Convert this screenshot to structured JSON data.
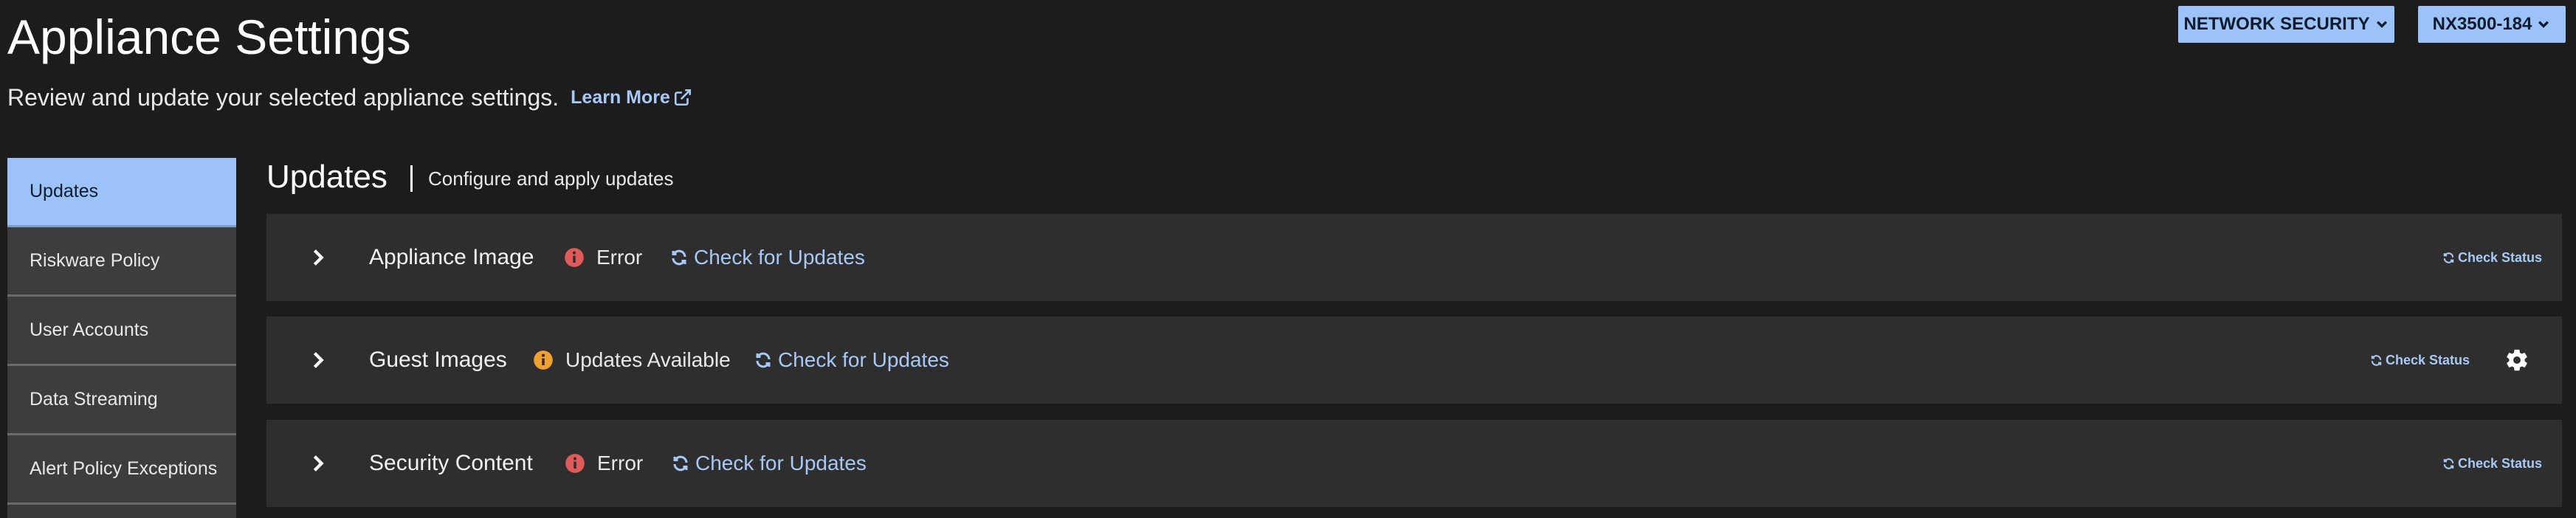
{
  "header": {
    "title": "Appliance Settings",
    "subtitle": "Review and update your selected appliance settings.",
    "learn_more": "Learn More",
    "buttons": {
      "network_security": "NETWORK SECURITY",
      "appliance": "NX3500-184"
    }
  },
  "sidebar": {
    "items": [
      {
        "label": "Updates",
        "active": true
      },
      {
        "label": "Riskware Policy",
        "active": false
      },
      {
        "label": "User Accounts",
        "active": false
      },
      {
        "label": "Data Streaming",
        "active": false
      },
      {
        "label": "Alert Policy Exceptions",
        "active": false
      }
    ]
  },
  "section": {
    "title": "Updates",
    "description": "Configure and apply updates"
  },
  "rows": [
    {
      "name": "Appliance Image",
      "status": "Error",
      "status_icon": "error-info-icon",
      "check_updates": "Check for Updates",
      "check_status": "Check Status"
    },
    {
      "name": "Guest Images",
      "status": "Updates Available",
      "status_icon": "warning-info-icon",
      "check_updates": "Check for Updates",
      "check_status": "Check Status",
      "has_settings": true
    },
    {
      "name": "Security Content",
      "status": "Error",
      "status_icon": "error-info-icon",
      "check_updates": "Check for Updates",
      "check_status": "Check Status"
    }
  ],
  "colors": {
    "background": "#1c1c1c",
    "accent": "#9cc3f7",
    "link": "#a8c8f5",
    "error": "#e05a5a",
    "warning": "#f0a030",
    "row_bg": "#2e2e2e"
  }
}
